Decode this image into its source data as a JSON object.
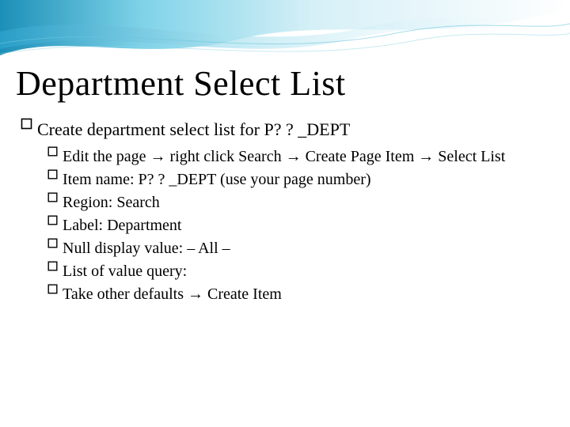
{
  "title": "Department Select List",
  "level1": {
    "text": "Create department select list for P? ? _DEPT"
  },
  "level2": [
    {
      "text": "Edit the page → right click Search → Create Page Item → Select List"
    },
    {
      "text": "Item name: P? ? _DEPT (use your page number)"
    },
    {
      "text": "Region: Search"
    },
    {
      "text": "Label: Department"
    },
    {
      "text": "Null display value: – All –"
    },
    {
      "text": "List of value query:"
    },
    {
      "text": "Take other defaults → Create Item"
    }
  ]
}
